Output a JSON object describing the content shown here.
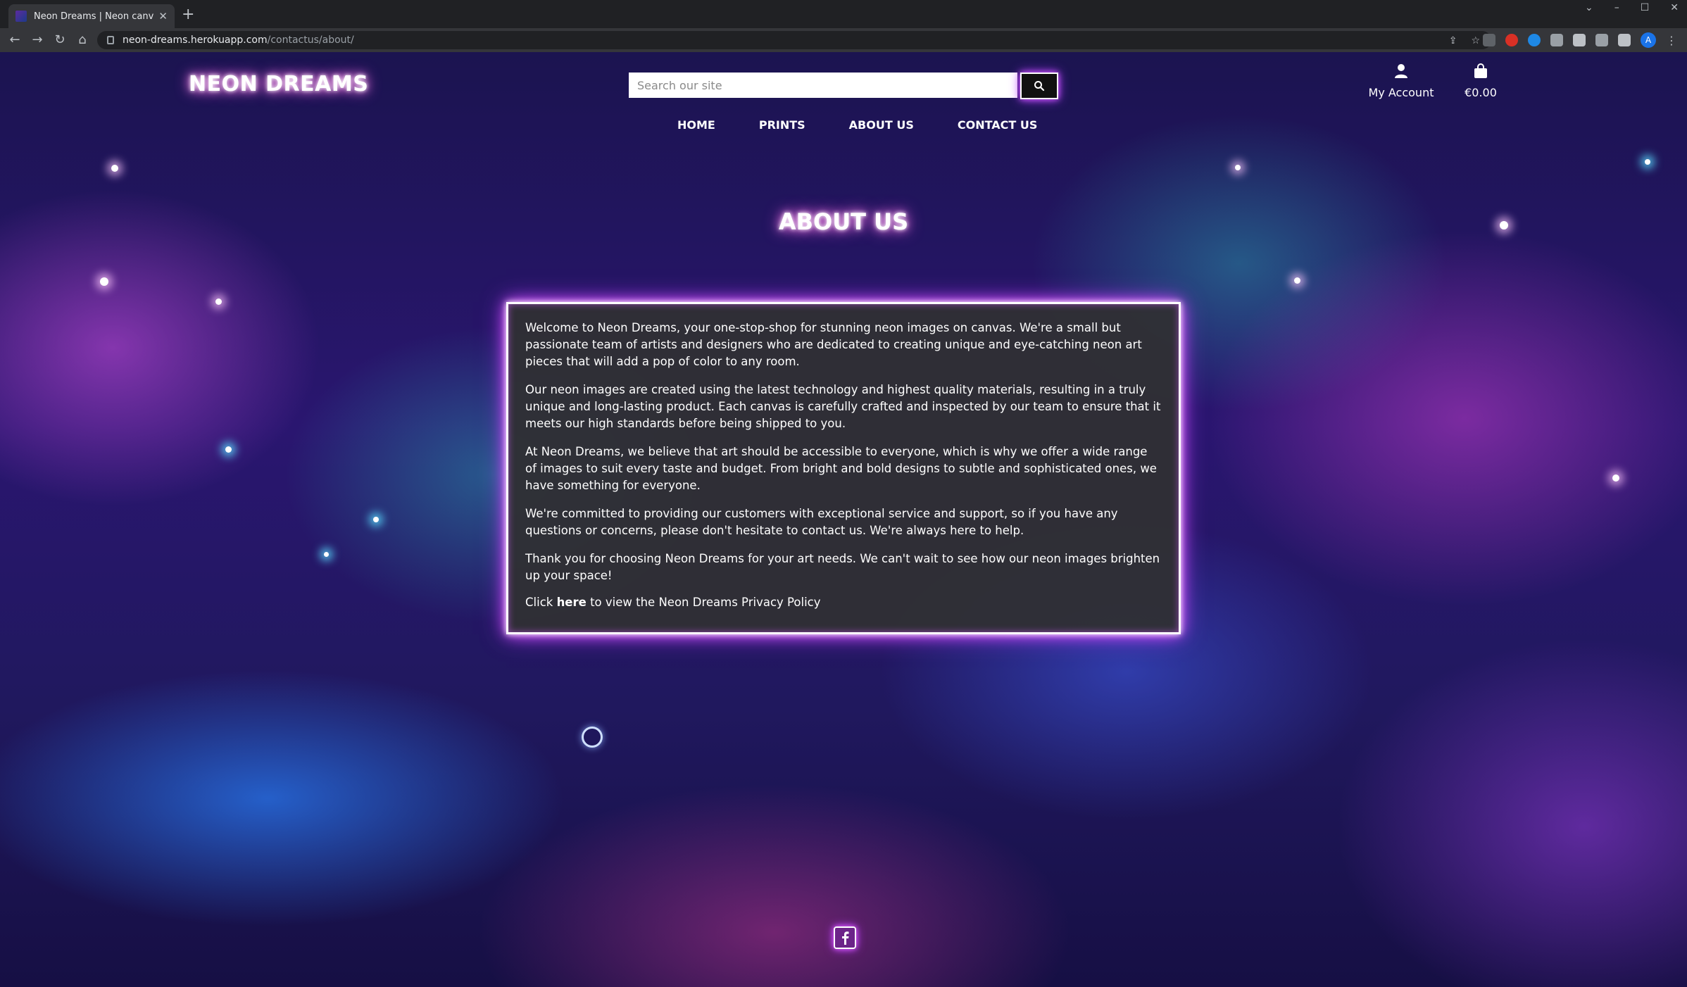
{
  "browser": {
    "tab_title": "Neon Dreams | Neon canvas pri",
    "url_host": "neon-dreams.herokuapp.com",
    "url_path": "/contactus/about/",
    "avatar_letter": "A"
  },
  "site": {
    "logo": "NEON DREAMS",
    "search_placeholder": "Search our site",
    "account_label": "My Account",
    "bag_total": "€0.00"
  },
  "nav": {
    "home": "HOME",
    "prints": "PRINTS",
    "about": "ABOUT US",
    "contact": "CONTACT US"
  },
  "main": {
    "title": "ABOUT US",
    "paragraphs": [
      "Welcome to Neon Dreams, your one-stop-shop for stunning neon images on canvas. We're a small but passionate team of artists and designers who are dedicated to creating unique and eye-catching neon art pieces that will add a pop of color to any room.",
      "Our neon images are created using the latest technology and highest quality materials, resulting in a truly unique and long-lasting product. Each canvas is carefully crafted and inspected by our team to ensure that it meets our high standards before being shipped to you.",
      "At Neon Dreams, we believe that art should be accessible to everyone, which is why we offer a wide range of images to suit every taste and budget. From bright and bold designs to subtle and sophisticated ones, we have something for everyone.",
      "We're committed to providing our customers with exceptional service and support, so if you have any questions or concerns, please don't hesitate to contact us. We're always here to help.",
      "Thank you for choosing Neon Dreams for your art needs. We can't wait to see how our neon images brighten up your space!"
    ],
    "privacy_prefix": "Click ",
    "privacy_link": "here",
    "privacy_suffix": " to view the Neon Dreams Privacy Policy"
  },
  "icons": {
    "search": "search-icon",
    "account": "user-icon",
    "bag": "shopping-bag-icon",
    "facebook": "facebook-icon"
  },
  "colors": {
    "neon_pink": "#ff52e0",
    "neon_purple": "#b73cff",
    "card_bg": "#303034"
  }
}
